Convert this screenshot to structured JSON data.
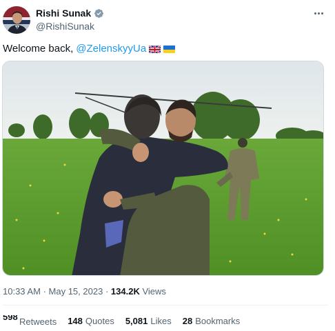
{
  "author": {
    "display_name": "Rishi Sunak",
    "handle": "@RishiSunak",
    "verified_icon": "verified-badge-icon",
    "verified_color": "#829aab"
  },
  "tweet": {
    "text_prefix": "Welcome back,",
    "mention": "@ZelenskyyUa",
    "emoji": [
      "uk-flag",
      "ukraine-flag"
    ]
  },
  "meta": {
    "time": "10:33 AM",
    "date": "May 15, 2023",
    "separator": "·",
    "views_count": "134.2K",
    "views_label": "Views"
  },
  "stats": {
    "retweets_count": "598",
    "retweets_label": "Retweets",
    "quotes_count": "148",
    "quotes_label": "Quotes",
    "likes_count": "5,081",
    "likes_label": "Likes",
    "bookmarks_count": "28",
    "bookmarks_label": "Bookmarks"
  },
  "colors": {
    "link": "#1d9bf0",
    "text": "#0f1419",
    "secondary": "#536471",
    "divider": "#eff3f4"
  }
}
